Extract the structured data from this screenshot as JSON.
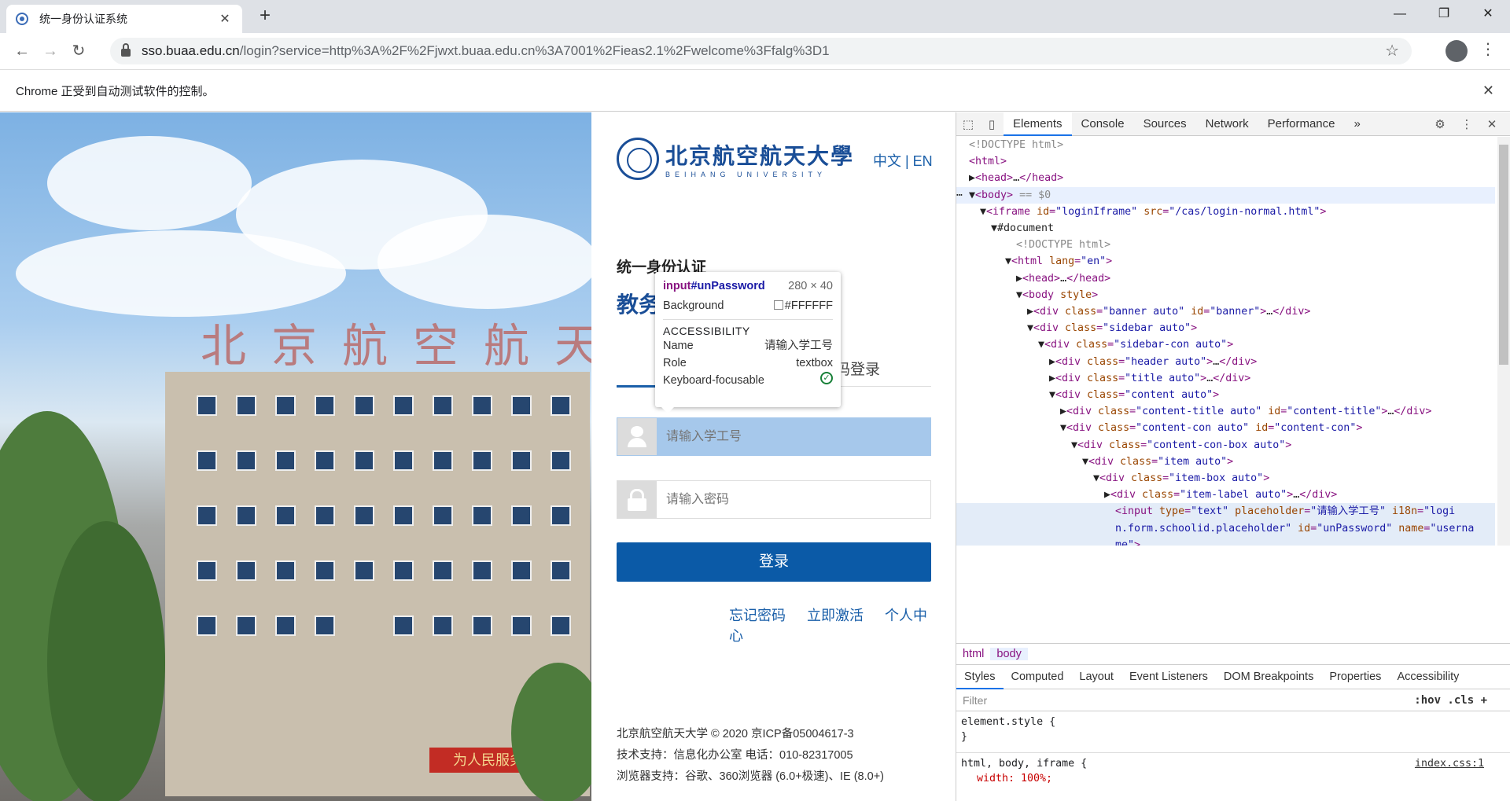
{
  "browser": {
    "tab_title": "统一身份认证系统",
    "url_host": "sso.buaa.edu.cn",
    "url_path": "/login?service=http%3A%2F%2Fjwxt.buaa.edu.cn%3A7001%2Fieas2.1%2Fwelcome%3Ffalg%3D1",
    "infobar_text": "Chrome 正受到自动测试软件的控制。"
  },
  "photo": {
    "roof_chars": [
      "北",
      "京",
      "航",
      "空",
      "航",
      "天"
    ],
    "banner_text": "为人民服务"
  },
  "login": {
    "logo_cn": "北京航空航天大學",
    "logo_en": "BEIHANG UNIVERSITY",
    "lang": "中文 | EN",
    "subtitle": "统一身份认证",
    "system_title": "教务",
    "tab_other": "码登录",
    "username_placeholder": "请输入学工号",
    "password_placeholder": "请输入密码",
    "login_button": "登录",
    "links": [
      "忘记密码",
      "立即激活",
      "个人中心"
    ],
    "footer": [
      "北京航空航天大学 © 2020 京ICP备05004617-3",
      "技术支持：信息化办公室 电话：010-82317005",
      "浏览器支持：谷歌、360浏览器 (6.0+极速)、IE (8.0+)"
    ]
  },
  "tooltip": {
    "tag": "input",
    "id": "#unPassword",
    "size": "280 × 40",
    "background_label": "Background",
    "background_value": "#FFFFFF",
    "section": "ACCESSIBILITY",
    "name_label": "Name",
    "name_value": "请输入学工号",
    "role_label": "Role",
    "role_value": "textbox",
    "focus_label": "Keyboard-focusable"
  },
  "devtools": {
    "tabs": [
      "Elements",
      "Console",
      "Sources",
      "Network",
      "Performance"
    ],
    "more": "»",
    "crumbs": [
      "html",
      "body"
    ],
    "style_tabs": [
      "Styles",
      "Computed",
      "Layout",
      "Event Listeners",
      "DOM Breakpoints",
      "Properties",
      "Accessibility"
    ],
    "filter_placeholder": "Filter",
    "filter_tools": ":hov  .cls  +",
    "style_rule1": "element.style {",
    "style_rule1_end": "}",
    "style_rule2": "html, body, iframe {",
    "style_rule2_src": "index.css:1",
    "style_prop": "width: 100%;"
  }
}
